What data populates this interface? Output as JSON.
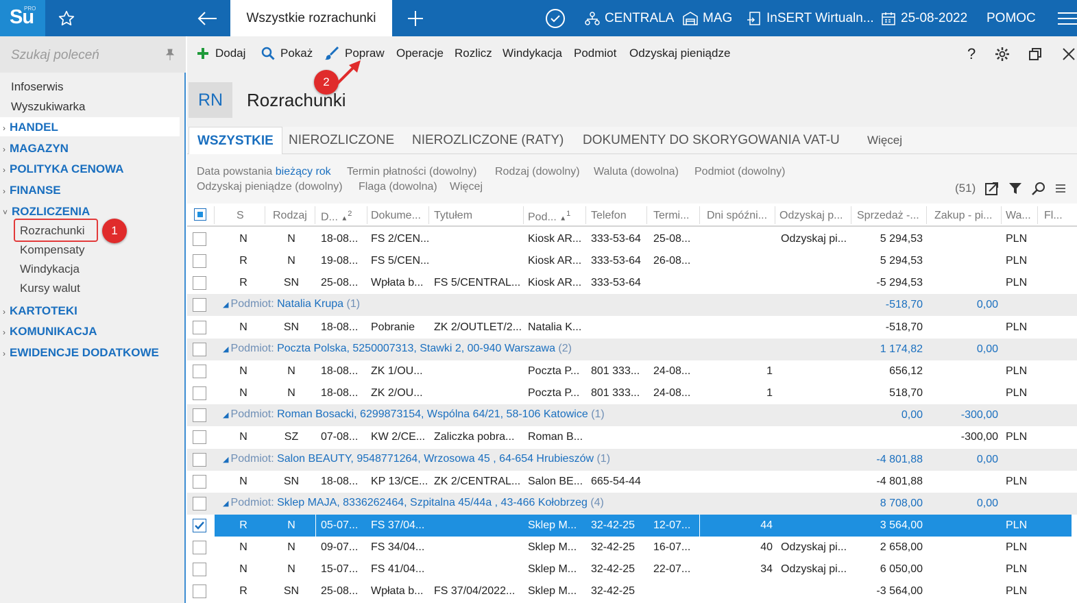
{
  "topbar": {
    "logo": "Su",
    "logo_pro": "PRO",
    "active_tab": "Wszystkie rozrachunki",
    "centrala": "CENTRALA",
    "mag": "MAG",
    "insert": "InSERT Wirtualn...",
    "date": "25-08-2022",
    "pomoc": "POMOC"
  },
  "sidebar": {
    "search_placeholder": "Szukaj poleceń",
    "items": [
      "Infoserwis",
      "Wyszukiwarka"
    ],
    "sections": [
      "HANDEL",
      "MAGAZYN",
      "POLITYKA CENOWA",
      "FINANSE",
      "ROZLICZENIA",
      "KARTOTEKI",
      "KOMUNIKACJA",
      "EWIDENCJE DODATKOWE"
    ],
    "sub": [
      "Rozrachunki",
      "Kompensaty",
      "Windykacja",
      "Kursy walut"
    ]
  },
  "badges": [
    "1",
    "2"
  ],
  "toolbar": {
    "dodaj": "Dodaj",
    "pokaz": "Pokaż",
    "popraw": "Popraw",
    "operacje": "Operacje",
    "rozlicz": "Rozlicz",
    "windykacja": "Windykacja",
    "podmiot": "Podmiot",
    "odzyskaj": "Odzyskaj pieniądze",
    "help": "?"
  },
  "header": {
    "code": "RN",
    "title": "Rozrachunki"
  },
  "tabs": [
    "WSZYSTKIE",
    "NIEROZLICZONE",
    "NIEROZLICZONE (RATY)",
    "DOKUMENTY DO SKORYGOWANIA VAT-U",
    "Więcej"
  ],
  "filters": {
    "data_label": "Data powstania",
    "data_value": "bieżący rok",
    "termin": "Termin płatności (dowolny)",
    "rodzaj": "Rodzaj (dowolny)",
    "waluta": "Waluta (dowolna)",
    "podmiot": "Podmiot (dowolny)",
    "odzyskaj": "Odzyskaj pieniądze (dowolny)",
    "flaga": "Flaga (dowolna)",
    "wiecej": "Więcej",
    "count": "(51)"
  },
  "columns": [
    "S",
    "Rodzaj",
    "D...",
    "Dokume...",
    "Tytułem",
    "Pod...",
    "Telefon",
    "Termi...",
    "Dni spóźni...",
    "Odzyskaj p...",
    "Sprzedaż -...",
    "Zakup - pi...",
    "Wa...",
    "Fl..."
  ],
  "sort_marks": [
    "2",
    "1"
  ],
  "rows": [
    {
      "type": "data",
      "s": "N",
      "rodzaj": "N",
      "d": "18-08...",
      "dok": "FS 2/CEN...",
      "tyt": "",
      "pod": "Kiosk AR...",
      "tel": "333-53-64",
      "term": "25-08...",
      "dni": "",
      "odz": "Odzyskaj pi...",
      "sprz": "5 294,53",
      "zak": "",
      "wa": "PLN"
    },
    {
      "type": "data",
      "s": "R",
      "rodzaj": "N",
      "d": "19-08...",
      "dok": "FS 5/CEN...",
      "tyt": "",
      "pod": "Kiosk AR...",
      "tel": "333-53-64",
      "term": "26-08...",
      "dni": "",
      "odz": "",
      "sprz": "5 294,53",
      "zak": "",
      "wa": "PLN"
    },
    {
      "type": "data",
      "s": "R",
      "rodzaj": "SN",
      "d": "25-08...",
      "dok": "Wpłata b...",
      "tyt": "FS 5/CENTRAL...",
      "pod": "Kiosk AR...",
      "tel": "333-53-64",
      "term": "",
      "dni": "",
      "odz": "",
      "sprz": "-5 294,53",
      "zak": "",
      "wa": "PLN"
    },
    {
      "type": "group",
      "prefix": "Podmiot:",
      "name": "Natalia Krupa",
      "count": "(1)",
      "sprz": "-518,70",
      "zak": "0,00"
    },
    {
      "type": "data",
      "s": "N",
      "rodzaj": "SN",
      "d": "18-08...",
      "dok": "Pobranie",
      "tyt": "ZK 2/OUTLET/2...",
      "pod": "Natalia K...",
      "tel": "",
      "term": "",
      "dni": "",
      "odz": "",
      "sprz": "-518,70",
      "zak": "",
      "wa": "PLN"
    },
    {
      "type": "group",
      "prefix": "Podmiot:",
      "name": "Poczta Polska, 5250007313, Stawki 2, 00-940 Warszawa",
      "count": "(2)",
      "sprz": "1 174,82",
      "zak": "0,00"
    },
    {
      "type": "data",
      "s": "N",
      "rodzaj": "N",
      "d": "18-08...",
      "dok": "ZK 1/OU...",
      "tyt": "",
      "pod": "Poczta P...",
      "tel": "801 333...",
      "term": "24-08...",
      "dni": "1",
      "odz": "",
      "sprz": "656,12",
      "zak": "",
      "wa": "PLN"
    },
    {
      "type": "data",
      "s": "N",
      "rodzaj": "N",
      "d": "18-08...",
      "dok": "ZK 2/OU...",
      "tyt": "",
      "pod": "Poczta P...",
      "tel": "801 333...",
      "term": "24-08...",
      "dni": "1",
      "odz": "",
      "sprz": "518,70",
      "zak": "",
      "wa": "PLN"
    },
    {
      "type": "group",
      "prefix": "Podmiot:",
      "name": "Roman Bosacki, 6299873154, Wspólna 64/21, 58-106 Katowice",
      "count": "(1)",
      "sprz": "0,00",
      "zak": "-300,00"
    },
    {
      "type": "data",
      "s": "N",
      "rodzaj": "SZ",
      "d": "07-08...",
      "dok": "KW 2/CE...",
      "tyt": "Zaliczka pobra...",
      "pod": "Roman B...",
      "tel": "",
      "term": "",
      "dni": "",
      "odz": "",
      "sprz": "",
      "zak": "-300,00",
      "wa": "PLN"
    },
    {
      "type": "group",
      "prefix": "Podmiot:",
      "name": "Salon BEAUTY, 9548771264, Wrzosowa  45 , 64-654 Hrubieszów",
      "count": "(1)",
      "sprz": "-4 801,88",
      "zak": "0,00"
    },
    {
      "type": "data",
      "s": "N",
      "rodzaj": "SN",
      "d": "18-08...",
      "dok": "KP 13/CE...",
      "tyt": "ZK 2/CENTRAL...",
      "pod": "Salon BE...",
      "tel": "665-54-44",
      "term": "",
      "dni": "",
      "odz": "",
      "sprz": "-4 801,88",
      "zak": "",
      "wa": "PLN"
    },
    {
      "type": "group",
      "prefix": "Podmiot:",
      "name": "Sklep MAJA, 8336262464, Szpitalna  45/44a , 43-466 Kołobrzeg",
      "count": "(4)",
      "sprz": "8 708,00",
      "zak": "0,00"
    },
    {
      "type": "sel",
      "s": "R",
      "rodzaj": "N",
      "d": "05-07...",
      "dok": "FS 37/04...",
      "tyt": "",
      "pod": "Sklep M...",
      "tel": "32-42-25",
      "term": "12-07...",
      "dni": "44",
      "odz": "",
      "sprz": "3 564,00",
      "zak": "",
      "wa": "PLN"
    },
    {
      "type": "data",
      "s": "N",
      "rodzaj": "N",
      "d": "09-07...",
      "dok": "FS 34/04...",
      "tyt": "",
      "pod": "Sklep M...",
      "tel": "32-42-25",
      "term": "16-07...",
      "dni": "40",
      "odz": "Odzyskaj pi...",
      "sprz": "2 658,00",
      "zak": "",
      "wa": "PLN"
    },
    {
      "type": "data",
      "s": "N",
      "rodzaj": "N",
      "d": "15-07...",
      "dok": "FS 41/04...",
      "tyt": "",
      "pod": "Sklep M...",
      "tel": "32-42-25",
      "term": "22-07...",
      "dni": "34",
      "odz": "Odzyskaj pi...",
      "sprz": "6 050,00",
      "zak": "",
      "wa": "PLN"
    },
    {
      "type": "data",
      "s": "R",
      "rodzaj": "SN",
      "d": "25-08...",
      "dok": "Wpłata b...",
      "tyt": "FS 37/04/2022...",
      "pod": "Sklep M...",
      "tel": "32-42-25",
      "term": "",
      "dni": "",
      "odz": "",
      "sprz": "-3 564,00",
      "zak": "",
      "wa": "PLN"
    }
  ]
}
